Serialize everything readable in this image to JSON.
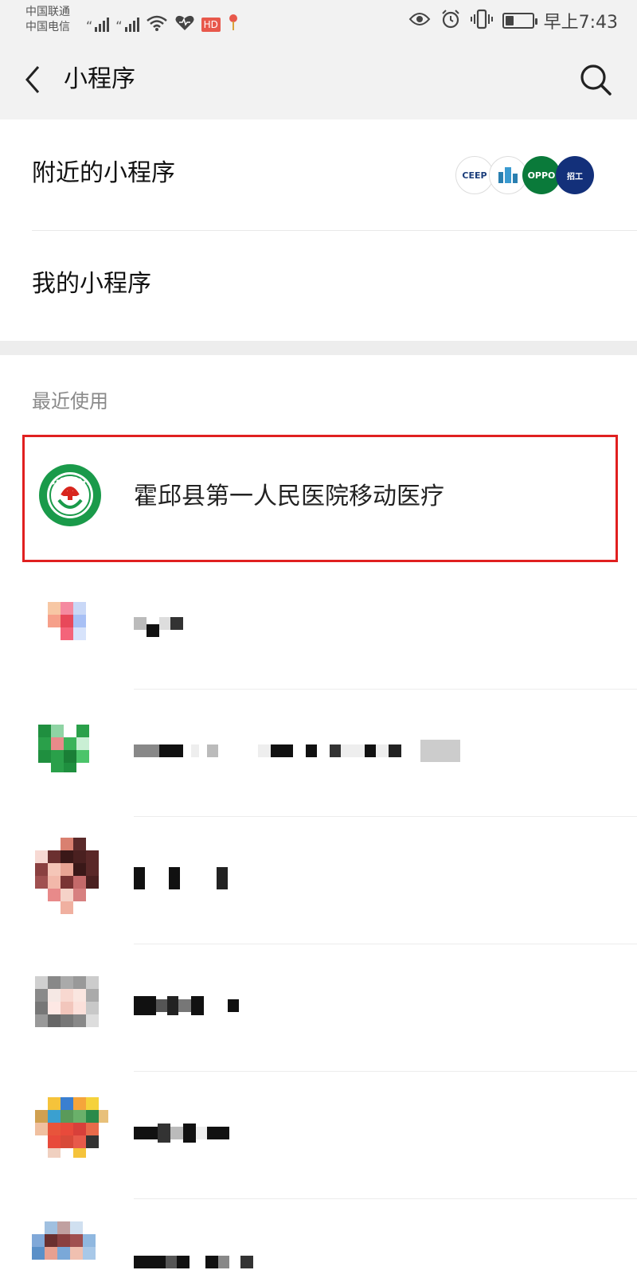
{
  "status_bar": {
    "carrier_1": "中国联通",
    "carrier_2": "中国电信",
    "hd_badge": "HD",
    "time": "早上7:43",
    "battery_level_pct": 30,
    "icons": [
      "signal-icon",
      "wifi-icon",
      "heart-icon",
      "location-icon",
      "eye-icon",
      "alarm-icon",
      "vibrate-icon",
      "battery-icon"
    ]
  },
  "nav": {
    "title": "小程序",
    "back_icon": "back-chevron-icon",
    "search_icon": "search-icon"
  },
  "menu": {
    "nearby_label": "附近的小程序",
    "nearby_logo_a": "CEEP",
    "nearby_logo_c": "OPPO",
    "nearby_logo_d": "招工",
    "mine_label": "我的小程序"
  },
  "recent": {
    "header": "最近使用",
    "items": [
      {
        "name": "霍邱县第一人民医院移动医疗",
        "highlighted": true
      },
      {
        "name": "",
        "pixelated": true
      },
      {
        "name": "",
        "pixelated": true
      },
      {
        "name": "",
        "pixelated": true
      },
      {
        "name": "",
        "pixelated": true
      },
      {
        "name": "",
        "pixelated": true
      },
      {
        "name": "",
        "pixelated": true
      }
    ]
  },
  "colors": {
    "highlight_border": "#e02020",
    "background": "#ededed",
    "section_header": "#8a8a8a",
    "hospital_green": "#1a9a4a"
  }
}
